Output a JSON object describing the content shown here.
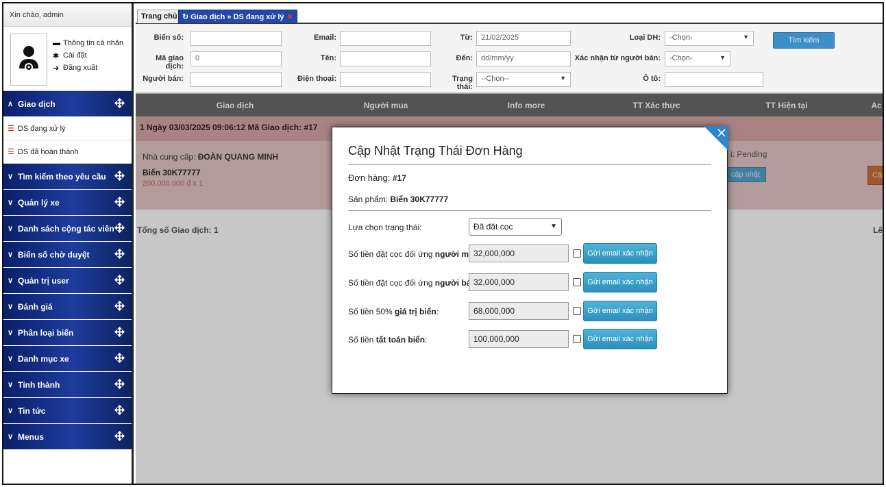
{
  "sidebar": {
    "greeting": "Xin chào, admin",
    "profile_links": [
      "Thông tin cá nhân",
      "Cài đặt",
      "Đăng xuất"
    ],
    "menu": {
      "giao_dich": "Giao dịch",
      "ds_dang_xu_ly": "DS đang xử lý",
      "ds_da_hoan_thanh": "DS đã hoàn thành",
      "tim_kiem": "Tìm kiếm theo yêu cầu",
      "quan_ly_xe": "Quản lý xe",
      "cong_tac_vien": "Danh sách cộng tác viên",
      "bien_so_cho_duyet": "Biển số chờ duyệt",
      "quan_tri_user": "Quản trị user",
      "danh_gia": "Đánh giá",
      "phan_loai_bien": "Phân loại biển",
      "danh_muc_xe": "Danh mục xe",
      "tinh_thanh": "Tỉnh thành",
      "tin_tuc": "Tin tức",
      "menus": "Menus"
    }
  },
  "tabs": {
    "home": "Trang chủ",
    "active": "Giao dịch » DS đang xử lý"
  },
  "filters": {
    "bien_so": "Biển số:",
    "ma_giao_dich": "Mã giao dịch:",
    "ma_giao_dich_value": "0",
    "nguoi_ban": "Người bán:",
    "email": "Email:",
    "ten": "Tên:",
    "dien_thoai": "Điện thoại:",
    "tu": "Từ:",
    "tu_value": "21/02/2025",
    "den": "Đến:",
    "den_value": "dd/mm/yy",
    "trang_thai": "Trạng thái:",
    "trang_thai_value": "--Chọn--",
    "loai_dh": "Loại DH:",
    "loai_dh_value": "-Chọn-",
    "xac_nhan": "Xác nhận từ người bán:",
    "xac_nhan_value": "-Chọn-",
    "o_to": "Ô tô:",
    "search_button": "Tìm kiếm"
  },
  "table": {
    "headers": [
      "Giao dịch",
      "Người mua",
      "Info more",
      "TT Xác thực",
      "TT Hiện tại",
      "Ac"
    ],
    "group": "1  Ngày 03/03/2025 09:06:12  Mã Giao dịch: #17",
    "supplier_label": "Nhà cung cấp:",
    "supplier_name": "ĐOÀN QUANG MINH",
    "plate": "Biển 30K77777",
    "price": "200.000.000 đ x 1",
    "status": "i: Pending",
    "update_btn": "cập nhật",
    "update_btn2": "Cập",
    "total": "Tổng số Giao dịch: 1",
    "right_text": "Lê"
  },
  "modal": {
    "title": "Cập Nhật Trạng Thái Đơn Hàng",
    "order_label": "Đơn hàng:",
    "order_value": "#17",
    "product_label": "Sản phẩm:",
    "product_value": "Biển 30K77777",
    "status_label": "Lựa chọn trạng thái:",
    "status_value": "Đã đặt cọc",
    "rows": [
      {
        "prefix": "Số tiền đặt cọc đối ứng ",
        "bold": "người mua",
        "suffix": ":",
        "value": "32,000,000"
      },
      {
        "prefix": "Số tiền đặt cọc đối ứng ",
        "bold": "người bán",
        "suffix": ":",
        "value": "32,000,000"
      },
      {
        "prefix": "Số tiền 50% ",
        "bold": "giá trị biển",
        "suffix": ":",
        "value": "68,000,000"
      },
      {
        "prefix": "Số tiền ",
        "bold": "tất toán biển",
        "suffix": ":",
        "value": "100,000,000"
      }
    ],
    "email_button": "Gửi email xác nhận"
  },
  "colors": {
    "nav_blue": "#1d3c9c",
    "row_pink": "#e8c8c8",
    "button_blue": "#2c8fbd"
  }
}
